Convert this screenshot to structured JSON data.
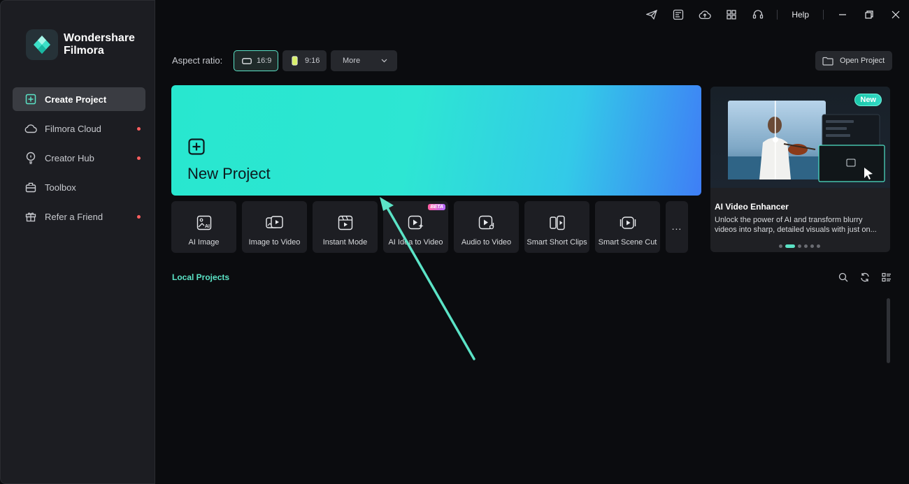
{
  "app": {
    "brand_line1": "Wondershare",
    "brand_line2": "Filmora"
  },
  "sidebar": {
    "items": [
      {
        "label": "Create Project",
        "icon": "plus-square-icon",
        "active": true,
        "dot": false
      },
      {
        "label": "Filmora Cloud",
        "icon": "cloud-icon",
        "active": false,
        "dot": true
      },
      {
        "label": "Creator Hub",
        "icon": "bulb-icon",
        "active": false,
        "dot": true
      },
      {
        "label": "Toolbox",
        "icon": "toolbox-icon",
        "active": false,
        "dot": false
      },
      {
        "label": "Refer a Friend",
        "icon": "gift-icon",
        "active": false,
        "dot": true
      }
    ]
  },
  "titlebar": {
    "help_label": "Help"
  },
  "aspect": {
    "label": "Aspect ratio:",
    "options": [
      "16:9",
      "9:16"
    ],
    "selected": "16:9",
    "more_label": "More"
  },
  "open_project_label": "Open Project",
  "new_project_label": "New Project",
  "tools": [
    {
      "label": "AI Image",
      "icon": "ai-image-icon"
    },
    {
      "label": "Image to Video",
      "icon": "image-to-video-icon"
    },
    {
      "label": "Instant Mode",
      "icon": "instant-mode-icon"
    },
    {
      "label": "AI Idea to Video",
      "icon": "ai-idea-video-icon",
      "badge": "BETA"
    },
    {
      "label": "Audio to Video",
      "icon": "audio-to-video-icon"
    },
    {
      "label": "Smart Short Clips",
      "icon": "smart-short-clips-icon"
    },
    {
      "label": "Smart Scene Cut",
      "icon": "smart-scene-cut-icon"
    }
  ],
  "tools_more_label": "...",
  "promo": {
    "badge": "New",
    "title": "AI Video Enhancer",
    "description": "Unlock the power of AI and transform blurry videos into sharp, detailed visuals with just on...",
    "pages": 6,
    "active_page": 1
  },
  "local": {
    "title": "Local Projects"
  },
  "colors": {
    "accent": "#5be3c6",
    "banner_start": "#28e7cf",
    "banner_end": "#3f7ef6",
    "notification_dot": "#ff5f5f"
  }
}
